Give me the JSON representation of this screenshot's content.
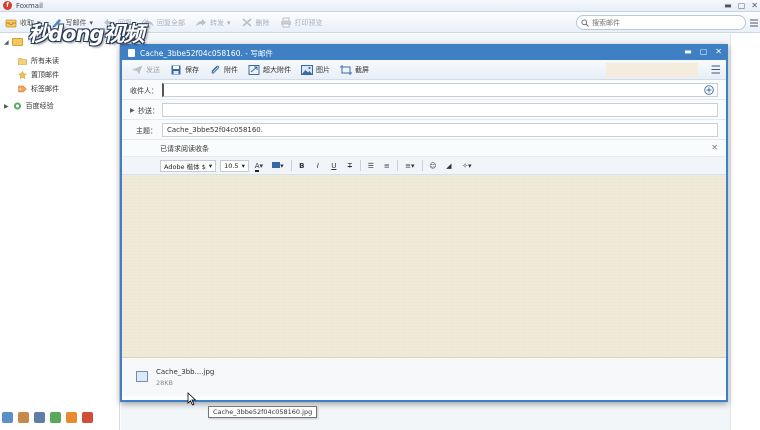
{
  "app": {
    "title": "Foxmail",
    "watermark": "秒dong视频"
  },
  "main_toolbar": {
    "receive": "收取",
    "compose": "写邮件",
    "reply": "回复",
    "reply_all": "回复全部",
    "forward": "转发",
    "delete": "删除",
    "print": "打印预览"
  },
  "search": {
    "placeholder": "搜索邮件"
  },
  "sidebar": {
    "items": [
      {
        "label": "所有未读"
      },
      {
        "label": "置顶邮件"
      },
      {
        "label": "标签邮件"
      },
      {
        "label": "百度经验"
      }
    ]
  },
  "compose": {
    "title": "Cache_3bbe52f04c058160. - 写邮件",
    "toolbar": {
      "send": "发送",
      "save": "保存",
      "attach": "附件",
      "big_attach": "超大附件",
      "image": "图片",
      "screenshot": "截屏"
    },
    "to_label": "收件人：",
    "to_value": "",
    "cc_label": "抄送：",
    "cc_value": "",
    "subject_label": "主题：",
    "subject_value": "Cache_3bbe52f04c058160.",
    "notice": "已请求阅读收条",
    "format": {
      "font": "Adobe 楷体 $",
      "size": "10.5"
    },
    "attachment": {
      "name": "Cache_3bb....jpg",
      "size": "28KB"
    }
  },
  "tooltip": "Cache_3bbe52f04c058160.jpg",
  "colors": {
    "accent": "#3f7fc4",
    "editor_bg": "#f1ead9"
  }
}
